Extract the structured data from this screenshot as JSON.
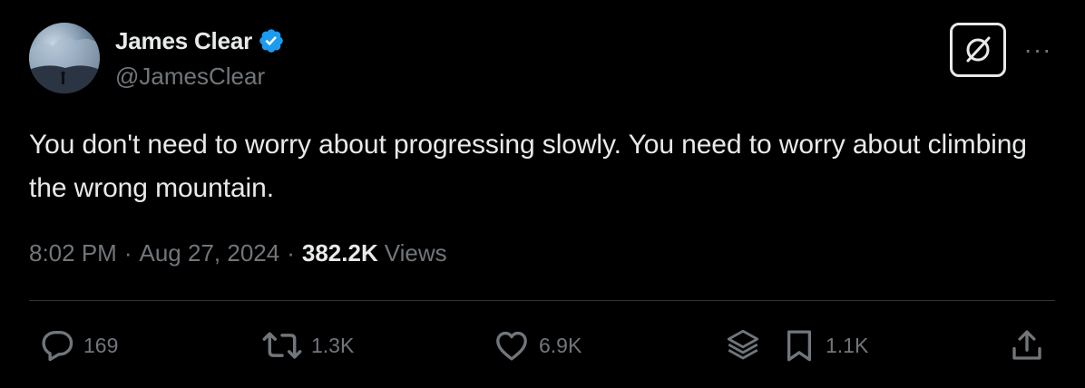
{
  "author": {
    "display_name": "James Clear",
    "handle": "@JamesClear",
    "verified": true,
    "verified_color": "#1d9bf0"
  },
  "tweet": {
    "text": "You don't need to worry about progressing slowly. You need to worry about climbing the wrong mountain.",
    "time": "8:02 PM",
    "separator": "·",
    "date": "Aug 27, 2024",
    "views_count": "382.2K",
    "views_label": "Views"
  },
  "actions": {
    "replies": {
      "icon": "reply-icon",
      "count": "169"
    },
    "reposts": {
      "icon": "repost-icon",
      "count": "1.3K"
    },
    "likes": {
      "icon": "heart-icon",
      "count": "6.9K"
    },
    "grok": {
      "icon": "layers-icon"
    },
    "bookmarks": {
      "icon": "bookmark-icon",
      "count": "1.1K"
    },
    "share": {
      "icon": "share-icon"
    }
  },
  "header_buttons": {
    "grok": {
      "icon": "grok-icon"
    },
    "more": {
      "icon": "more-icon",
      "label": "···"
    }
  },
  "colors": {
    "background": "#000000",
    "primary_text": "#e7e9ea",
    "secondary_text": "#71767b",
    "divider": "#2f3336"
  }
}
